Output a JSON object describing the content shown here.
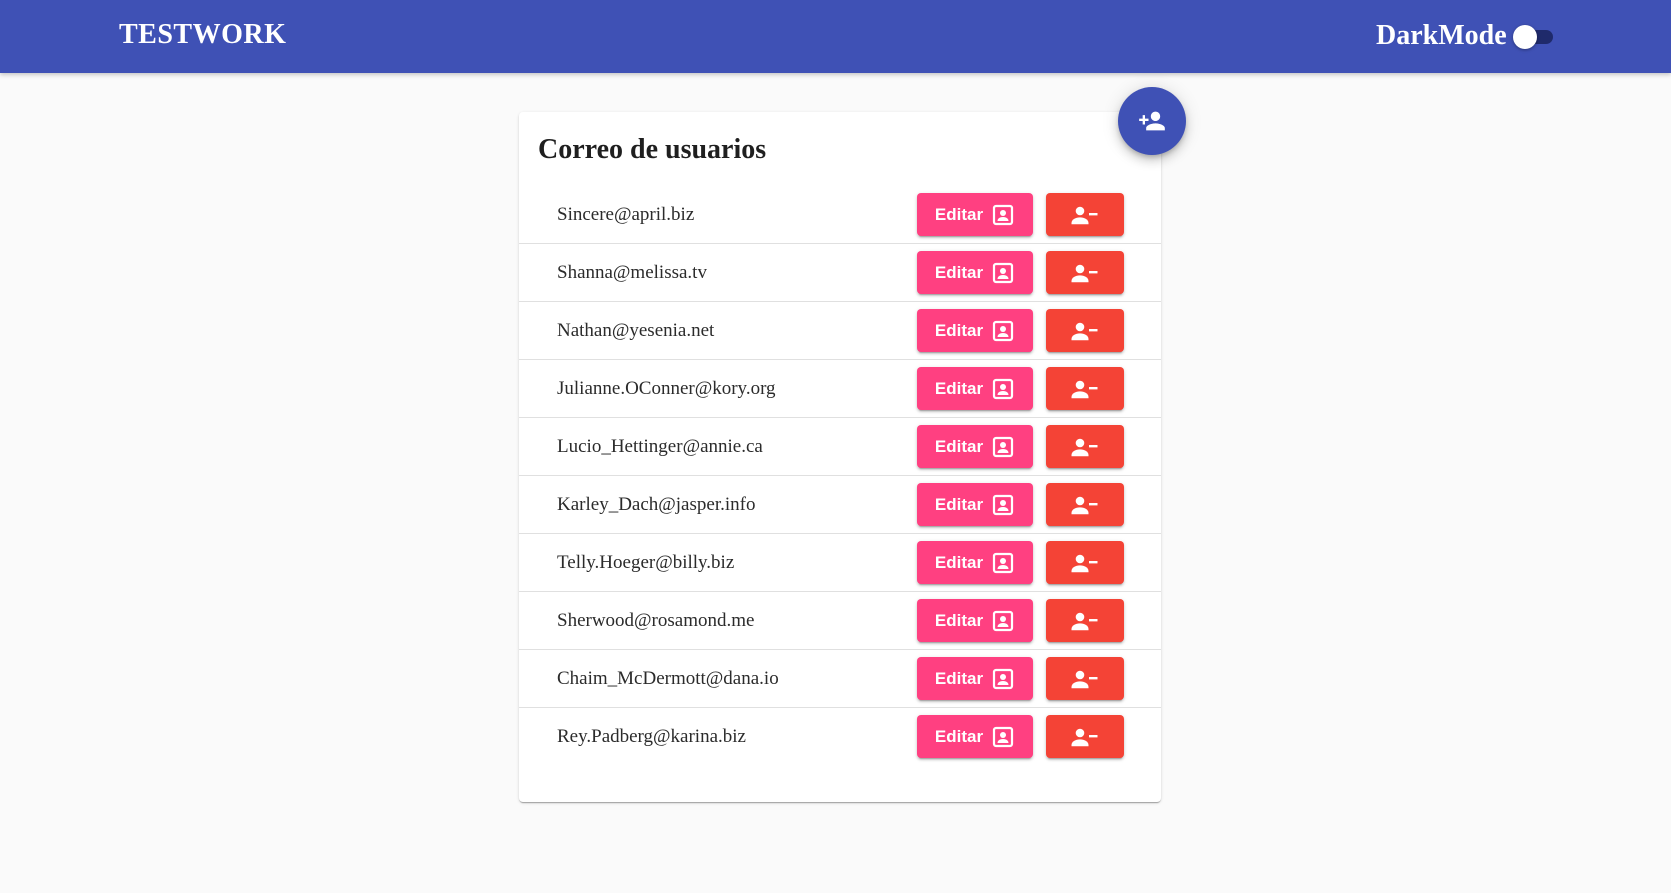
{
  "appbar": {
    "brand": "TESTWORK",
    "darkmode_label": "DarkMode",
    "darkmode_on": false,
    "color": "#3f51b5"
  },
  "card": {
    "title": "Correo de usuarios"
  },
  "fab": {
    "icon": "person-add-icon"
  },
  "actions": {
    "edit_label": "Editar",
    "edit_icon": "contact-card-icon",
    "delete_icon": "person-remove-icon",
    "edit_color": "#ff4081",
    "delete_color": "#f44336"
  },
  "users": [
    {
      "email": "Sincere@april.biz"
    },
    {
      "email": "Shanna@melissa.tv"
    },
    {
      "email": "Nathan@yesenia.net"
    },
    {
      "email": "Julianne.OConner@kory.org"
    },
    {
      "email": "Lucio_Hettinger@annie.ca"
    },
    {
      "email": "Karley_Dach@jasper.info"
    },
    {
      "email": "Telly.Hoeger@billy.biz"
    },
    {
      "email": "Sherwood@rosamond.me"
    },
    {
      "email": "Chaim_McDermott@dana.io"
    },
    {
      "email": "Rey.Padberg@karina.biz"
    }
  ]
}
